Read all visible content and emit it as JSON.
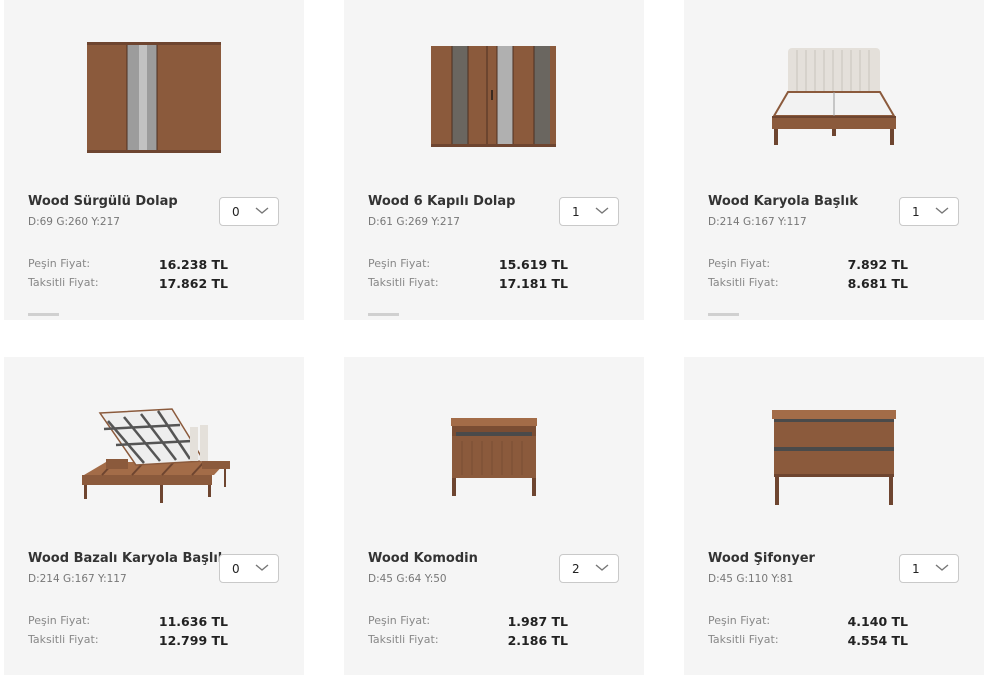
{
  "products": [
    {
      "name": "Wood Sürgülü Dolap",
      "dims": "D:69 G:260 Y:217",
      "qty": "0",
      "cash_label": "Peşin Fiyat:",
      "cash_price": "16.238 TL",
      "inst_label": "Taksitli Fiyat:",
      "inst_price": "17.862 TL",
      "icon": "sliding-wardrobe"
    },
    {
      "name": "Wood 6 Kapılı Dolap",
      "dims": "D:61 G:269 Y:217",
      "qty": "1",
      "cash_label": "Peşin Fiyat:",
      "cash_price": "15.619 TL",
      "inst_label": "Taksitli Fiyat:",
      "inst_price": "17.181 TL",
      "icon": "six-door-wardrobe"
    },
    {
      "name": "Wood Karyola Başlık",
      "dims": "D:214 G:167 Y:117",
      "qty": "1",
      "cash_label": "Peşin Fiyat:",
      "cash_price": "7.892 TL",
      "inst_label": "Taksitli Fiyat:",
      "inst_price": "8.681 TL",
      "icon": "bed-with-headboard"
    },
    {
      "name": "Wood Bazalı Karyola Başlık",
      "dims": "D:214 G:167 Y:117",
      "qty": "0",
      "cash_label": "Peşin Fiyat:",
      "cash_price": "11.636 TL",
      "inst_label": "Taksitli Fiyat:",
      "inst_price": "12.799 TL",
      "icon": "storage-bed"
    },
    {
      "name": "Wood Komodin",
      "dims": "D:45 G:64 Y:50",
      "qty": "2",
      "cash_label": "Peşin Fiyat:",
      "cash_price": "1.987 TL",
      "inst_label": "Taksitli Fiyat:",
      "inst_price": "2.186 TL",
      "icon": "nightstand"
    },
    {
      "name": "Wood Şifonyer",
      "dims": "D:45 G:110 Y:81",
      "qty": "1",
      "cash_label": "Peşin Fiyat:",
      "cash_price": "4.140 TL",
      "inst_label": "Taksitli Fiyat:",
      "inst_price": "4.554 TL",
      "icon": "dresser"
    }
  ],
  "colors": {
    "card_bg": "#f5f5f5",
    "wood": "#8b5a3c",
    "wood_dark": "#6e4530",
    "mirror": "#a9a9a9",
    "fabric": "#e4e0da"
  }
}
